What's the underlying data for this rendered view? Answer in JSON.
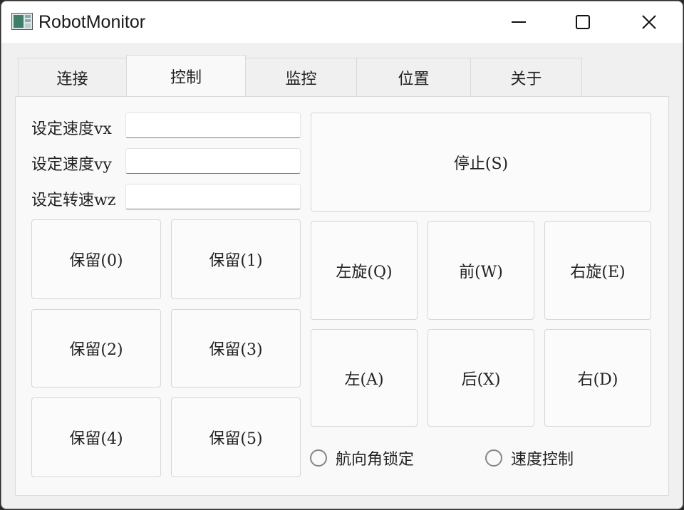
{
  "window": {
    "title": "RobotMonitor"
  },
  "tabs": [
    {
      "label": "连接"
    },
    {
      "label": "控制"
    },
    {
      "label": "监控"
    },
    {
      "label": "位置"
    },
    {
      "label": "关于"
    }
  ],
  "form": {
    "vx": {
      "label": "设定速度vx",
      "value": ""
    },
    "vy": {
      "label": "设定速度vy",
      "value": ""
    },
    "wz": {
      "label": "设定转速wz",
      "value": ""
    }
  },
  "reserved_buttons": [
    "保留(0)",
    "保留(1)",
    "保留(2)",
    "保留(3)",
    "保留(4)",
    "保留(5)"
  ],
  "control": {
    "stop": "停止(S)",
    "rotate_left": "左旋(Q)",
    "forward": "前(W)",
    "rotate_right": "右旋(E)",
    "left": "左(A)",
    "backward": "后(X)",
    "right": "右(D)"
  },
  "options": {
    "heading_lock": "航向角锁定",
    "speed_control": "速度控制"
  }
}
